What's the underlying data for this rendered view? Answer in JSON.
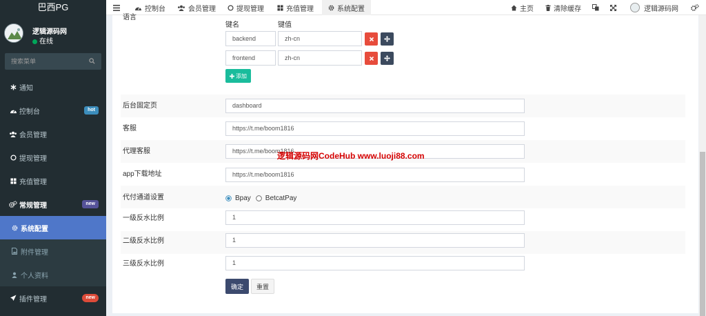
{
  "sidebar": {
    "logo": "巴西PG",
    "user": {
      "name": "逻辑源码网",
      "status": "在线"
    },
    "search_placeholder": "搜索菜单",
    "items": [
      {
        "label": "通知"
      },
      {
        "label": "控制台",
        "badge": "hot"
      },
      {
        "label": "会员管理"
      },
      {
        "label": "提现管理"
      },
      {
        "label": "充值管理"
      },
      {
        "label": "常规管理",
        "badge": "new"
      },
      {
        "label": "系统配置"
      },
      {
        "label": "附件管理"
      },
      {
        "label": "个人资料"
      },
      {
        "label": "插件管理",
        "badge": "new"
      }
    ]
  },
  "topbar": {
    "tabs": [
      {
        "label": "控制台"
      },
      {
        "label": "会员管理"
      },
      {
        "label": "提现管理"
      },
      {
        "label": "充值管理"
      },
      {
        "label": "系统配置"
      }
    ],
    "home": "主页",
    "clear_cache": "清除缓存",
    "user_name": "逻辑源码网"
  },
  "form": {
    "lang_label_partial": "语言",
    "kv_header_key": "键名",
    "kv_header_value": "键值",
    "kv_rows": [
      {
        "key": "backend",
        "value": "zh-cn"
      },
      {
        "key": "frontend",
        "value": "zh-cn"
      }
    ],
    "add_button": "添加",
    "fields": [
      {
        "label": "后台固定页",
        "value": "dashboard"
      },
      {
        "label": "客服",
        "value": "https://t.me/boom1816"
      },
      {
        "label": "代理客服",
        "value": "https://t.me/boom1816"
      },
      {
        "label": "app下载地址",
        "value": "https://t.me/boom1816"
      }
    ],
    "channel": {
      "label": "代付通道设置",
      "options": [
        "Bpay",
        "BetcatPay"
      ],
      "selected": "Bpay"
    },
    "rebates": [
      {
        "label": "一级反水比例",
        "value": "1"
      },
      {
        "label": "二级反水比例",
        "value": "1"
      },
      {
        "label": "三级反水比例",
        "value": "1"
      }
    ],
    "submit_button": "确定",
    "reset_button": "重置"
  },
  "watermark": "逻辑源码网CodeHub www.luoji88.com",
  "colors": {
    "sidebar_bg": "#222d32",
    "active": "#4f77c9",
    "add": "#1abc9c",
    "submit": "#3c4a6e",
    "delete": "#e74c3c",
    "radio": "#3c8dbc"
  }
}
